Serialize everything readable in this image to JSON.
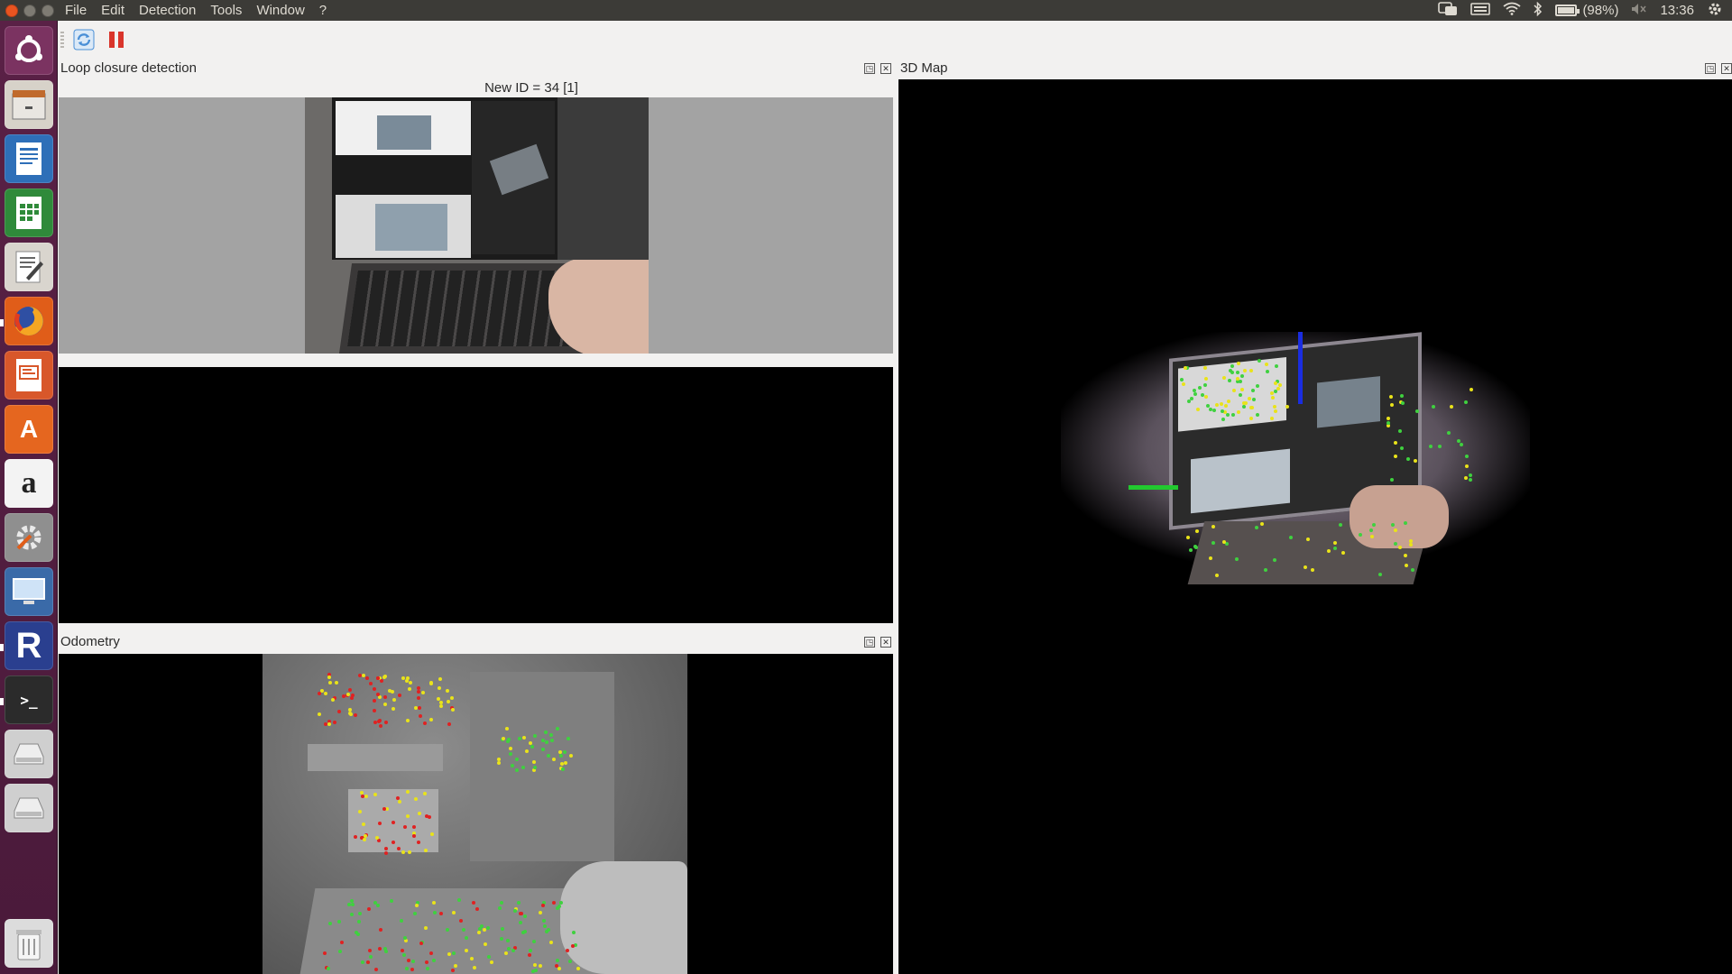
{
  "menubar": {
    "menus": [
      "File",
      "Edit",
      "Detection",
      "Tools",
      "Window",
      "?"
    ],
    "battery_text": "(98%)",
    "battery_level": 0.98,
    "clock": "13:36",
    "icons": [
      "keyboard-layout-icon",
      "keyboard-icon",
      "wifi-icon",
      "bluetooth-icon",
      "battery-icon",
      "volume-muted-icon",
      "gear-icon"
    ]
  },
  "launcher": {
    "items": [
      "ubuntu-dash-icon",
      "files-icon",
      "writer-icon",
      "calc-icon",
      "text-editor-icon",
      "firefox-icon",
      "impress-icon",
      "software-center-icon",
      "amazon-icon",
      "system-settings-icon",
      "remote-desktop-icon",
      "rtabmap-icon",
      "terminal-icon",
      "drive-icon",
      "drive-icon",
      "trash-icon"
    ],
    "letters": {
      "amazon": "a",
      "rtabmap": "R",
      "terminal": ">_",
      "software": "A"
    }
  },
  "toolbar": {
    "icons": [
      "refresh-icon",
      "pause-icon"
    ],
    "colors": {
      "refresh": "#4a8fd6",
      "pause": "#d9352b"
    }
  },
  "loop_closure": {
    "title": "Loop closure detection",
    "new_id_label": "New ID = 34 [1]"
  },
  "odometry": {
    "title": "Odometry"
  },
  "map3d": {
    "title": "3D Map"
  },
  "colors": {
    "launcher_bg": "#5a2146",
    "topbar_bg": "#3c3b37",
    "feature_yellow": "#e9e31a",
    "feature_green": "#3fd13f",
    "feature_red": "#e02222",
    "axis_blue": "#1a2de0",
    "axis_green": "#22c92f"
  }
}
